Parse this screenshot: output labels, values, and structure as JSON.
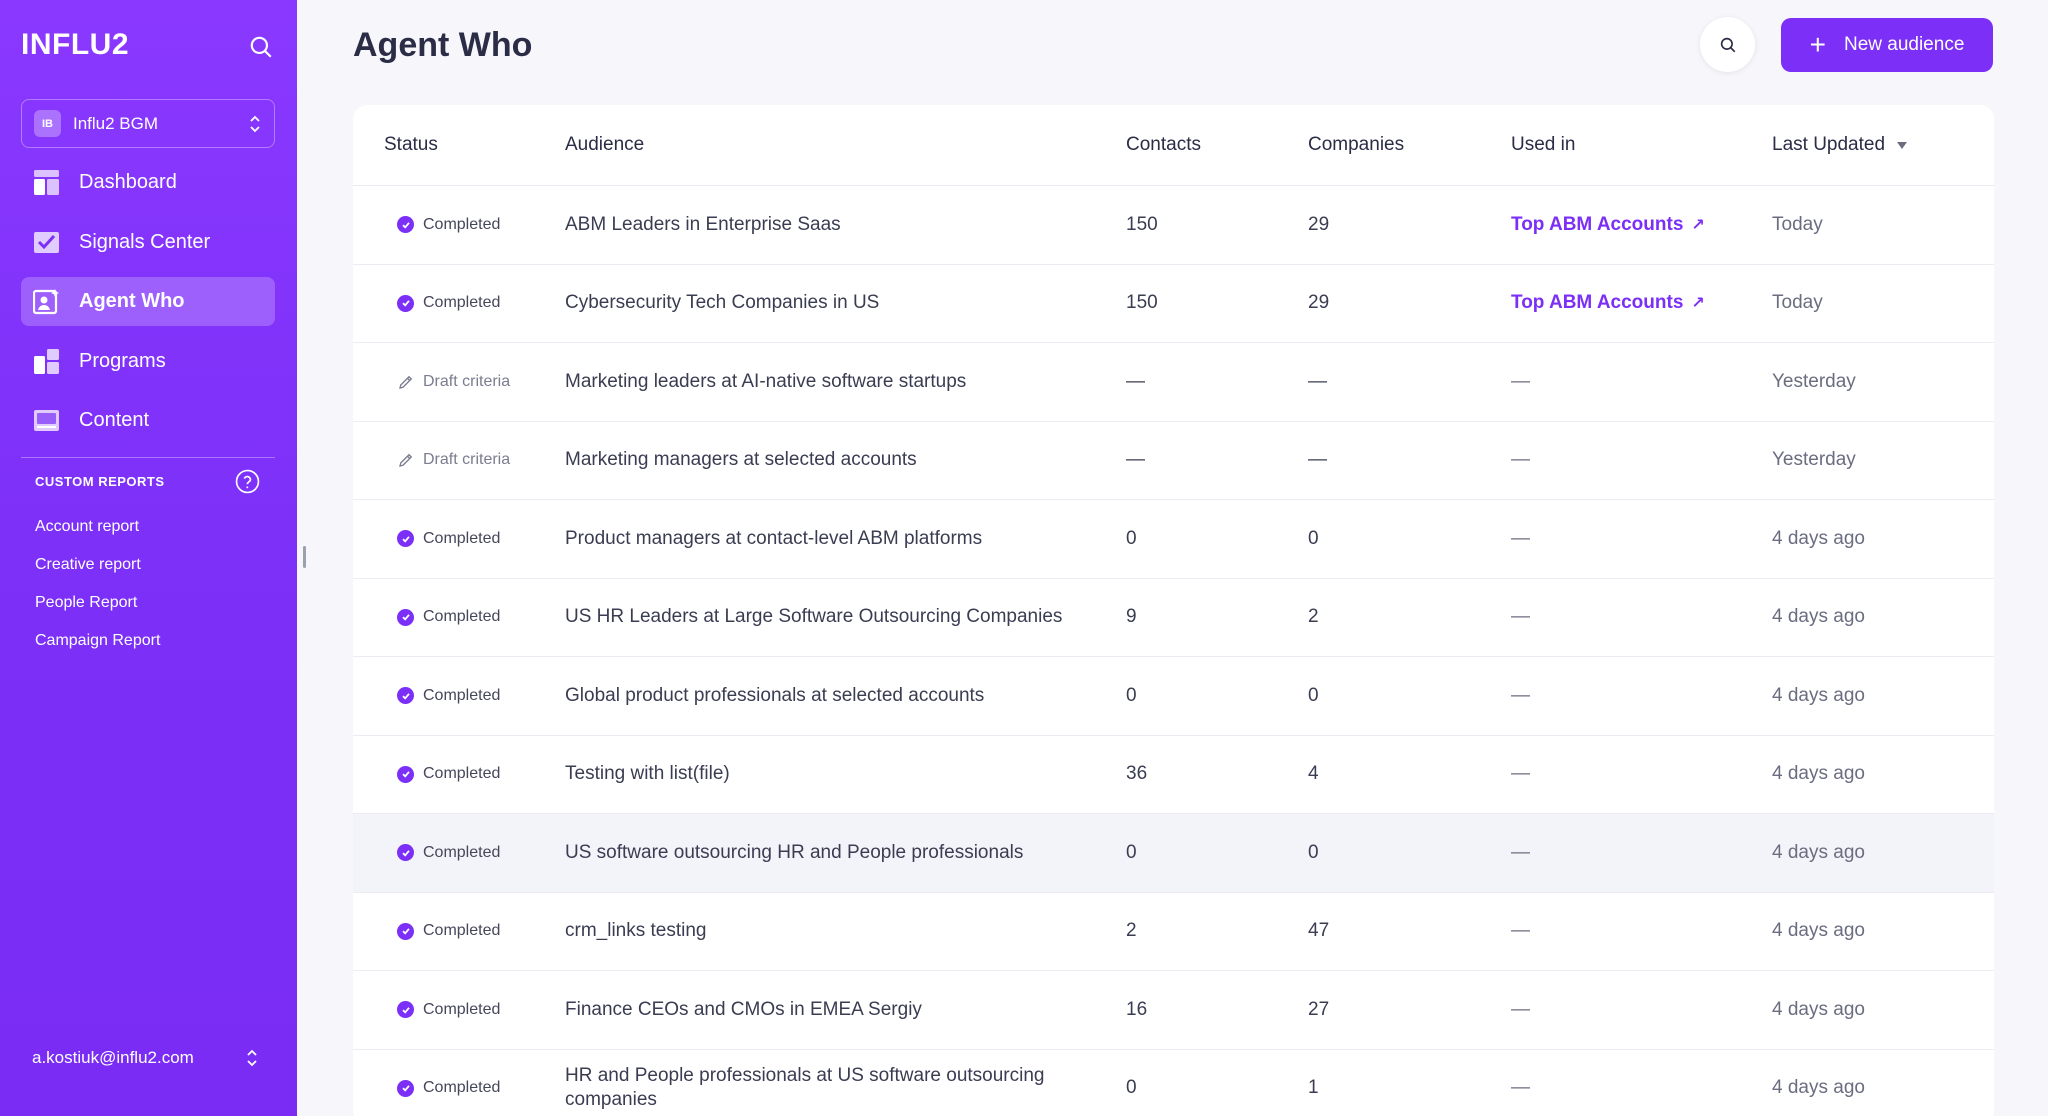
{
  "sidebar": {
    "brand": "INFLU2",
    "workspace": {
      "badge": "IB",
      "name": "Influ2 BGM"
    },
    "nav": [
      {
        "label": "Dashboard",
        "icon": "dashboard-icon"
      },
      {
        "label": "Signals Center",
        "icon": "signals-icon"
      },
      {
        "label": "Agent Who",
        "icon": "agent-who-icon",
        "active": true
      },
      {
        "label": "Programs",
        "icon": "programs-icon"
      },
      {
        "label": "Content",
        "icon": "content-icon"
      }
    ],
    "custom_reports_title": "CUSTOM REPORTS",
    "reports": [
      "Account report",
      "Creative report",
      "People Report",
      "Campaign Report"
    ],
    "user_email": "a.kostiuk@influ2.com"
  },
  "header": {
    "title": "Agent Who",
    "new_button_label": "New audience"
  },
  "table": {
    "columns": [
      "Status",
      "Audience",
      "Contacts",
      "Companies",
      "Used in",
      "Last Updated"
    ],
    "rows": [
      {
        "status": "Completed",
        "audience": "ABM Leaders in Enterprise Saas",
        "contacts": "150",
        "companies": "29",
        "used_in": "Top ABM Accounts",
        "last_updated": "Today"
      },
      {
        "status": "Completed",
        "audience": "Cybersecurity Tech Companies in US",
        "contacts": "150",
        "companies": "29",
        "used_in": "Top ABM Accounts",
        "last_updated": "Today"
      },
      {
        "status": "Draft criteria",
        "audience": "Marketing leaders at AI-native software startups",
        "contacts": "—",
        "companies": "—",
        "used_in": "—",
        "last_updated": "Yesterday"
      },
      {
        "status": "Draft criteria",
        "audience": "Marketing managers at selected accounts",
        "contacts": "—",
        "companies": "—",
        "used_in": "—",
        "last_updated": "Yesterday"
      },
      {
        "status": "Completed",
        "audience": "Product managers at contact-level ABM platforms",
        "contacts": "0",
        "companies": "0",
        "used_in": "—",
        "last_updated": "4 days ago"
      },
      {
        "status": "Completed",
        "audience": "US HR Leaders at Large Software Outsourcing Companies",
        "contacts": "9",
        "companies": "2",
        "used_in": "—",
        "last_updated": "4 days ago"
      },
      {
        "status": "Completed",
        "audience": "Global product professionals at selected accounts",
        "contacts": "0",
        "companies": "0",
        "used_in": "—",
        "last_updated": "4 days ago"
      },
      {
        "status": "Completed",
        "audience": "Testing with list(file)",
        "contacts": "36",
        "companies": "4",
        "used_in": "—",
        "last_updated": "4 days ago"
      },
      {
        "status": "Completed",
        "audience": "US software outsourcing HR and People professionals",
        "contacts": "0",
        "companies": "0",
        "used_in": "—",
        "last_updated": "4 days ago",
        "highlighted": true
      },
      {
        "status": "Completed",
        "audience": "crm_links testing",
        "contacts": "2",
        "companies": "47",
        "used_in": "—",
        "last_updated": "4 days ago"
      },
      {
        "status": "Completed",
        "audience": "Finance CEOs and CMOs in EMEA Sergiy",
        "contacts": "16",
        "companies": "27",
        "used_in": "—",
        "last_updated": "4 days ago"
      },
      {
        "status": "Completed",
        "audience": "HR and People professionals at US software outsourcing companies",
        "contacts": "0",
        "companies": "1",
        "used_in": "—",
        "last_updated": "4 days ago"
      }
    ]
  },
  "colors": {
    "accent": "#7b2ff7",
    "sidebar_top": "#8a38ff"
  }
}
